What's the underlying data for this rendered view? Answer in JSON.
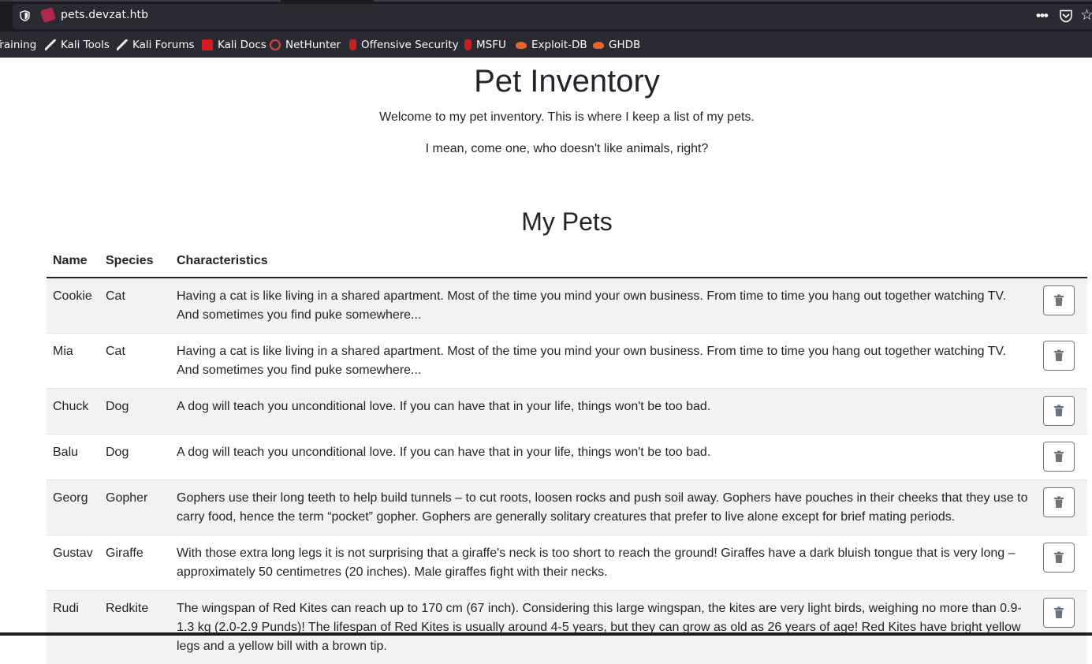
{
  "browser": {
    "url": "pets.devzat.htb",
    "bookmarks": [
      {
        "label": "Training",
        "icon": "kali-dragon-icon"
      },
      {
        "label": "Kali Tools",
        "icon": "kali-dragon-icon"
      },
      {
        "label": "Kali Forums",
        "icon": "kali-dragon-icon"
      },
      {
        "label": "Kali Docs",
        "icon": "kali-docs-icon"
      },
      {
        "label": "NetHunter",
        "icon": "nethunter-icon"
      },
      {
        "label": "Offensive Security",
        "icon": "offsec-icon"
      },
      {
        "label": "MSFU",
        "icon": "offsec-icon"
      },
      {
        "label": "Exploit-DB",
        "icon": "exploit-db-icon"
      },
      {
        "label": "GHDB",
        "icon": "exploit-db-icon"
      }
    ]
  },
  "page": {
    "title": "Pet Inventory",
    "intro1": "Welcome to my pet inventory. This is where I keep a list of my pets.",
    "intro2": "I mean, come one, who doesn't like animals, right?",
    "section_title": "My Pets"
  },
  "table": {
    "headers": {
      "name": "Name",
      "species": "Species",
      "characteristics": "Characteristics"
    },
    "rows": [
      {
        "name": "Cookie",
        "species": "Cat",
        "characteristics": "Having a cat is like living in a shared apartment. Most of the time you mind your own business. From time to time you hang out together watching TV. And sometimes you find puke somewhere..."
      },
      {
        "name": "Mia",
        "species": "Cat",
        "characteristics": "Having a cat is like living in a shared apartment. Most of the time you mind your own business. From time to time you hang out together watching TV. And sometimes you find puke somewhere..."
      },
      {
        "name": "Chuck",
        "species": "Dog",
        "characteristics": "A dog will teach you unconditional love. If you can have that in your life, things won't be too bad."
      },
      {
        "name": "Balu",
        "species": "Dog",
        "characteristics": "A dog will teach you unconditional love. If you can have that in your life, things won't be too bad."
      },
      {
        "name": "Georg",
        "species": "Gopher",
        "characteristics": "Gophers use their long teeth to help build tunnels – to cut roots, loosen rocks and push soil away. Gophers have pouches in their cheeks that they use to carry food, hence the term “pocket” gopher. Gophers are generally solitary creatures that prefer to live alone except for brief mating periods."
      },
      {
        "name": "Gustav",
        "species": "Giraffe",
        "characteristics": "With those extra long legs it is not surprising that a giraffe's neck is too short to reach the ground! Giraffes have a dark bluish tongue that is very long – approximately 50 centimetres (20 inches). Male giraffes fight with their necks."
      },
      {
        "name": "Rudi",
        "species": "Redkite",
        "characteristics": "The wingspan of Red Kites can reach up to 170 cm (67 inch). Considering this large wingspan, the kites are very light birds, weighing no more than 0.9-1.3 kg (2.0-2.9 Punds)! The lifespan of Red Kites is usually around 4-5 years, but they can grow as old as 26 years of age! Red Kites have bright yellow legs and a yellow bill with a brown tip."
      }
    ]
  }
}
